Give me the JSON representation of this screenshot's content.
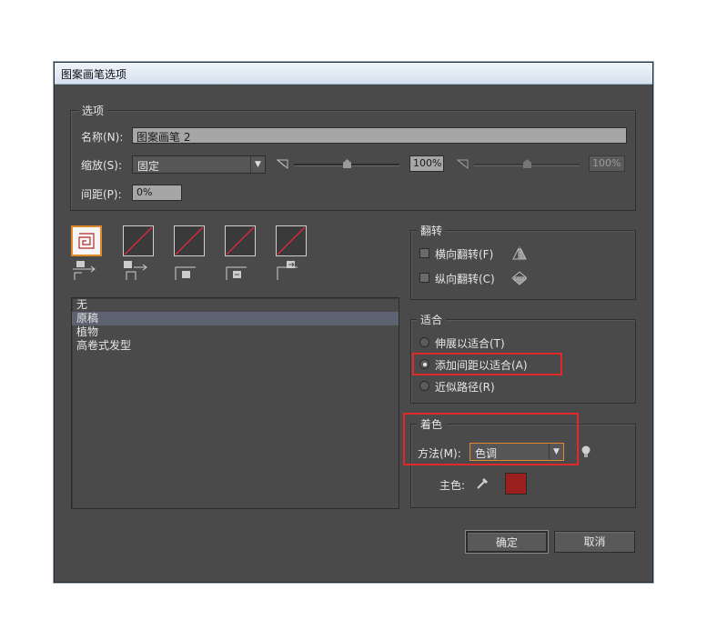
{
  "window": {
    "title": "图案画笔选项"
  },
  "options_group": {
    "legend": "选项",
    "name_label": "名称(N):",
    "name_value": "图案画笔 2",
    "scale_label": "缩放(S):",
    "scale_select": "固定",
    "scale_value1": "100%",
    "scale_value2": "100%",
    "scale_level1": 0.5,
    "scale_level2": 0.5,
    "spacing_label": "间距(P):",
    "spacing_value": "0%"
  },
  "tiles": [
    {
      "name": "side-tile",
      "selected": true
    },
    {
      "name": "outer-corner-tile",
      "selected": false
    },
    {
      "name": "inner-corner-tile",
      "selected": false
    },
    {
      "name": "start-tile",
      "selected": false
    },
    {
      "name": "end-tile",
      "selected": false
    }
  ],
  "pattern_list": {
    "items": [
      "无",
      "原稿",
      "植物",
      "高卷式发型"
    ],
    "selected_index": 1
  },
  "flip_group": {
    "legend": "翻转",
    "horizontal": "横向翻转(F)",
    "vertical": "纵向翻转(C)",
    "horizontal_checked": false,
    "vertical_checked": false
  },
  "fit_group": {
    "legend": "适合",
    "options": [
      "伸展以适合(T)",
      "添加间距以适合(A)",
      "近似路径(R)"
    ],
    "selected_index": 1
  },
  "colorization_group": {
    "legend": "着色",
    "method_label": "方法(M):",
    "method_value": "色调",
    "key_color_label": "主色:",
    "key_color": "#9b1f1f"
  },
  "buttons": {
    "ok": "确定",
    "cancel": "取消"
  },
  "colors": {
    "highlight_box": "#e02a2a",
    "selected_tile_border": "#e08a2c"
  },
  "icons": {
    "scale_small": "scale-small-icon",
    "scale_large": "scale-large-icon",
    "flip_horizontal": "flip-horizontal-icon",
    "flip_vertical": "flip-vertical-icon",
    "tips": "lightbulb-icon",
    "eyedropper": "eyedropper-icon"
  }
}
